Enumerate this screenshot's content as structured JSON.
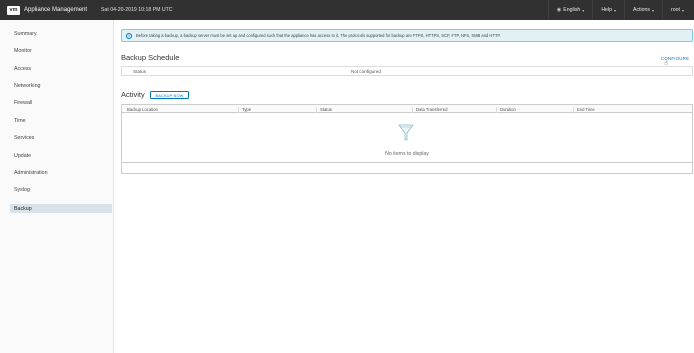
{
  "header": {
    "logo": "vm",
    "app_title": "Appliance Management",
    "datetime": "Sat 04-20-2019 10:18 PM UTC",
    "language": "English",
    "help": "Help",
    "actions": "Actions",
    "user": "root"
  },
  "sidebar": {
    "items": [
      {
        "label": "Summary"
      },
      {
        "label": "Monitor"
      },
      {
        "label": "Access"
      },
      {
        "label": "Networking"
      },
      {
        "label": "Firewall"
      },
      {
        "label": "Time"
      },
      {
        "label": "Services"
      },
      {
        "label": "Update"
      },
      {
        "label": "Administration"
      },
      {
        "label": "Syslog"
      },
      {
        "label": "Backup",
        "active": true
      }
    ]
  },
  "main": {
    "alert": "Before taking a backup, a backup server must be set up and configured such that the appliance has access to it. The protocols supported for backup are FTPS, HTTPS, SCP, FTP, NFS, SMB and HTTP.",
    "schedule_title": "Backup Schedule",
    "configure_label": "CONFIGURE",
    "status_label": "Status",
    "status_value": "Not configured",
    "activity_title": "Activity",
    "backup_now_label": "BACKUP NOW",
    "columns": [
      "Backup Location",
      "Type",
      "Status",
      "Data Transferred",
      "Duration",
      "End Time"
    ],
    "empty_text": "No items to display"
  },
  "colors": {
    "header_bg": "#313131",
    "accent": "#0079b8",
    "alert_bg": "#e1f1f6",
    "active_nav": "#d8e3e9"
  }
}
